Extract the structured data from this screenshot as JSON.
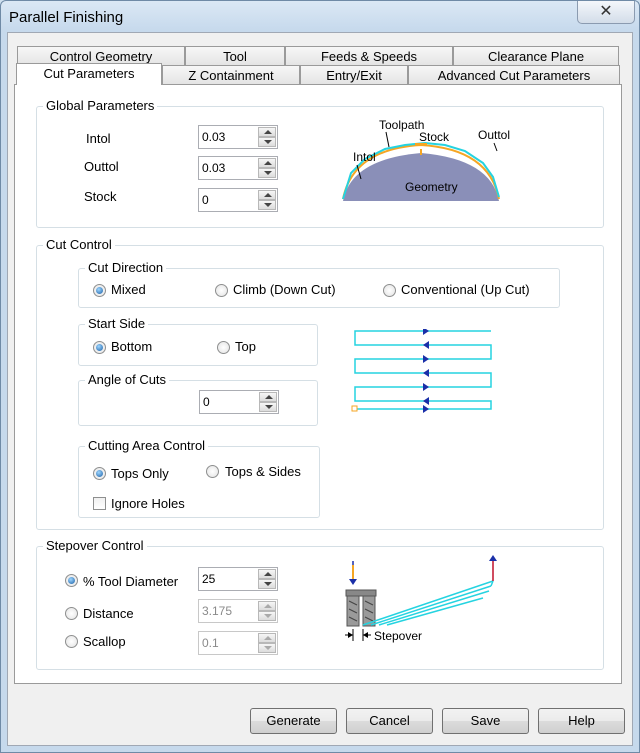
{
  "window": {
    "title": "Parallel Finishing",
    "close_glyph": "✕"
  },
  "tabs_back": [
    "Control Geometry",
    "Tool",
    "Feeds & Speeds",
    "Clearance Plane"
  ],
  "tabs_front": [
    "Cut Parameters",
    "Z Containment",
    "Entry/Exit",
    "Advanced Cut Parameters"
  ],
  "active_tab": "Cut Parameters",
  "global": {
    "legend": "Global Parameters",
    "intol_label": "Intol",
    "intol_value": "0.03",
    "outtol_label": "Outtol",
    "outtol_value": "0.03",
    "stock_label": "Stock",
    "stock_value": "0",
    "diagram": {
      "toolpath": "Toolpath",
      "stock": "Stock",
      "outtol": "Outtol",
      "intol": "Intol",
      "geometry": "Geometry"
    }
  },
  "cut_control": {
    "legend": "Cut Control",
    "cut_direction": {
      "legend": "Cut Direction",
      "options": [
        "Mixed",
        "Climb (Down Cut)",
        "Conventional (Up Cut)"
      ],
      "selected": "Mixed"
    },
    "start_side": {
      "legend": "Start Side",
      "options": [
        "Bottom",
        "Top"
      ],
      "selected": "Bottom"
    },
    "angle": {
      "legend": "Angle of Cuts",
      "value": "0"
    },
    "cutting_area": {
      "legend": "Cutting Area Control",
      "options": [
        "Tops Only",
        "Tops & Sides"
      ],
      "selected": "Tops Only",
      "ignore_holes_label": "Ignore Holes",
      "ignore_holes_checked": false
    }
  },
  "stepover": {
    "legend": "Stepover Control",
    "options": [
      {
        "label": "% Tool Diameter",
        "value": "25",
        "enabled": true
      },
      {
        "label": "Distance",
        "value": "3.175",
        "enabled": false
      },
      {
        "label": "Scallop",
        "value": "0.1",
        "enabled": false
      }
    ],
    "selected": "% Tool Diameter",
    "diagram_label": "Stepover"
  },
  "buttons": [
    "Generate",
    "Cancel",
    "Save",
    "Help"
  ],
  "colors": {
    "toolpath_cyan": "#25d3e0",
    "arrow_blue": "#1a2fa8",
    "stock_orange": "#f5a623",
    "geometry_fill": "#8a8fb8"
  }
}
